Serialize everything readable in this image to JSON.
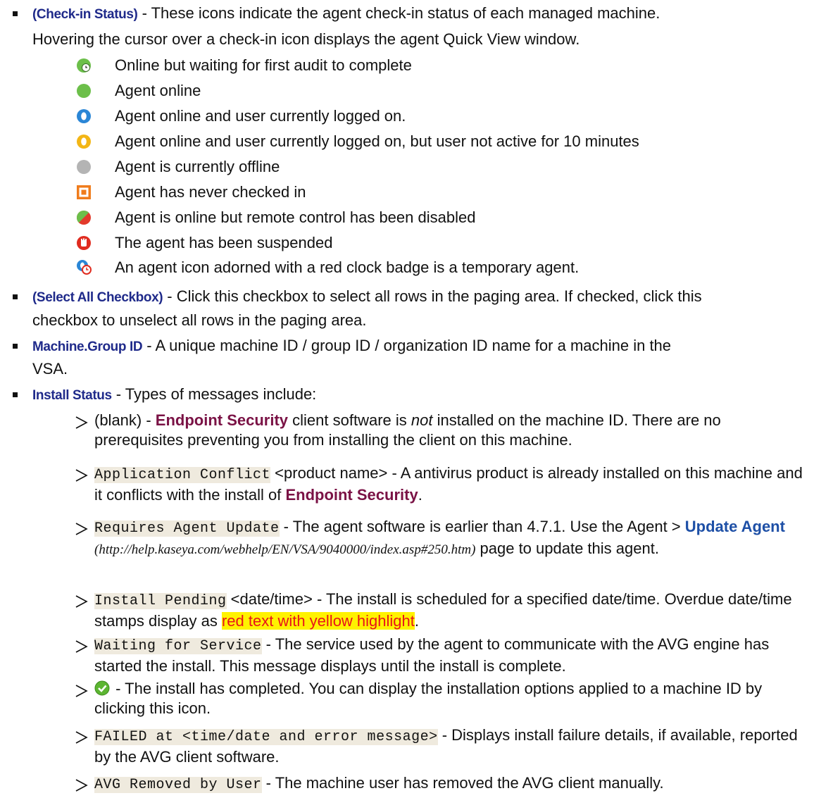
{
  "bullets": {
    "checkin": {
      "term": "(Check-in Status)",
      "desc_line1": " - These icons indicate the agent check-in status of each managed machine.",
      "desc_line2": "Hovering the cursor over a check-in icon displays the agent Quick View window.",
      "statuses": [
        {
          "icon": "green-clock-icon",
          "label": "Online but waiting for first audit to complete"
        },
        {
          "icon": "green-dot-icon",
          "label": "Agent online"
        },
        {
          "icon": "blue-user-icon",
          "label": "Agent online and user currently logged on."
        },
        {
          "icon": "yellow-user-icon",
          "label": "Agent online and user currently logged on, but user not active for 10 minutes"
        },
        {
          "icon": "gray-dot-icon",
          "label": "Agent is currently offline"
        },
        {
          "icon": "orange-square-icon",
          "label": "Agent has never checked in"
        },
        {
          "icon": "half-red-green-icon",
          "label": "Agent is online but remote control has been disabled"
        },
        {
          "icon": "red-hand-icon",
          "label": "The agent has been suspended"
        },
        {
          "icon": "temp-agent-clock-icon",
          "label": " An agent icon adorned with a red clock badge is a temporary agent."
        }
      ]
    },
    "selectall": {
      "term": "(Select All Checkbox)",
      "desc_line1": " - Click this checkbox to select all rows in the paging area. If checked, click this",
      "desc_line2": "checkbox to unselect all rows in the paging area."
    },
    "machine": {
      "term": "Machine.Group ID",
      "desc_line1": " - A unique machine ID / group ID / organization ID name for a machine in the",
      "desc_line2": "VSA."
    },
    "install": {
      "term": "Install Status",
      "desc": " - Types of messages include:"
    }
  },
  "messages": {
    "blank": {
      "prefix": "(blank) - ",
      "product": "Endpoint Security",
      "text1": " client software is ",
      "not": "not",
      "text2": " installed on the machine ID. There are no prerequisites preventing you from installing the client on this machine."
    },
    "conflict": {
      "code": "Application Conflict",
      "text1": " <product name> - A antivirus product is already installed on this machine and it conflicts with the install of ",
      "product": "Endpoint Security",
      "text2": "."
    },
    "update": {
      "code": "Requires Agent Update",
      "text1": " - The agent software is earlier than 4.7.1. Use the Agent > ",
      "link": "Update Agent",
      "url": " (http://help.kaseya.com/webhelp/EN/VSA/9040000/index.asp#250.htm)",
      "text2": " page to update this agent."
    },
    "pending": {
      "code": "Install Pending",
      "text1": " <date/time> - The install is scheduled for a specified date/time. Overdue date/time stamps display as ",
      "highlight": "red text with yellow highlight",
      "text2": "."
    },
    "waiting": {
      "code": "Waiting for Service",
      "text1": " - The service used by the agent to communicate with the AVG engine has started the install. This message displays until the install is complete."
    },
    "completed": {
      "icon": "green-check-icon",
      "text1": " - The install has completed. You can display the installation options applied to a machine ID by clicking this icon."
    },
    "failed": {
      "code": "FAILED at <time/date and error message>",
      "text1": " - Displays install failure details, if available, reported by the AVG client software."
    },
    "removed": {
      "code": "AVG Removed by User",
      "text1": " - The machine user has removed the AVG client manually."
    }
  }
}
